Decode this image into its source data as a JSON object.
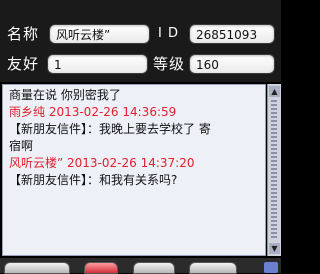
{
  "profile": {
    "name_label": "名称",
    "name_value": "风听云楼”",
    "id_label": "I D",
    "id_value": "26851093",
    "friend_label": "友好",
    "friend_value": "1",
    "level_label": "等级",
    "level_value": "160"
  },
  "chat": {
    "lines": [
      {
        "text": "商量在说   你别密我了",
        "type": "body"
      },
      {
        "text": "雨乡纯  2013-02-26 14:36:59",
        "type": "header"
      },
      {
        "text": "【新朋友信件】：我晚上要去学校了 寄",
        "type": "body"
      },
      {
        "text": "宿啊",
        "type": "body"
      },
      {
        "text": "风听云楼”  2013-02-26 14:37:20",
        "type": "header"
      },
      {
        "text": "【新朋友信件】：和我有关系吗?",
        "type": "body"
      }
    ]
  },
  "scrollbar": {
    "up_icon": "arrow-up-icon",
    "down_icon": "arrow-down-icon"
  }
}
